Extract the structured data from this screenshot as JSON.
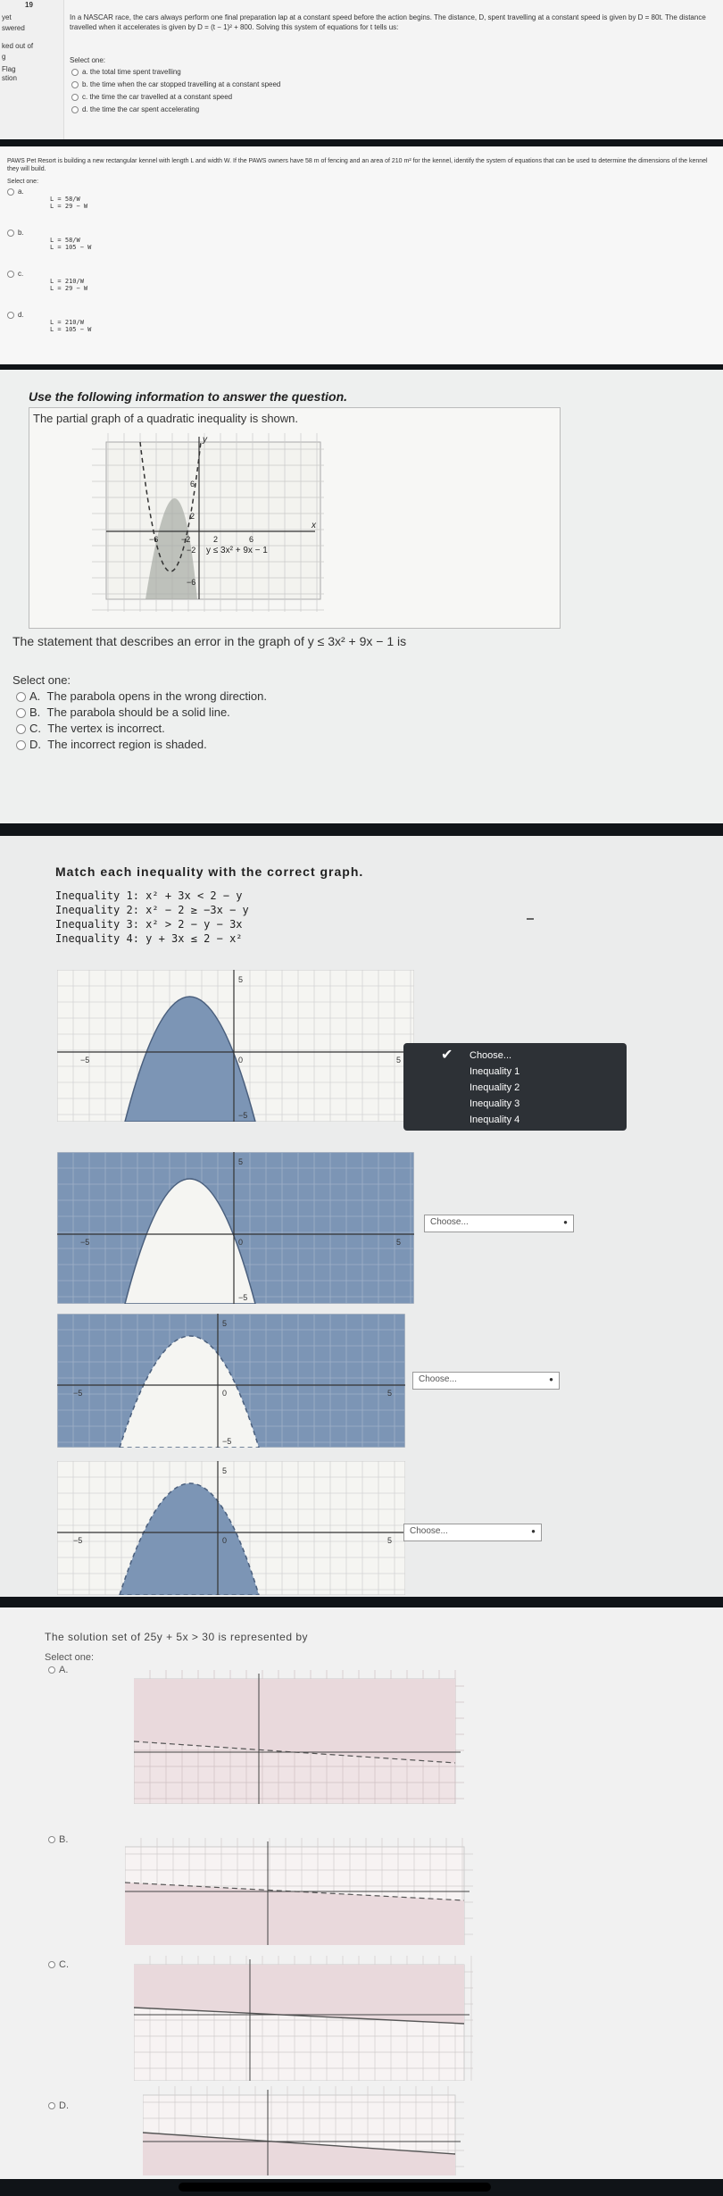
{
  "q1": {
    "sidebar": [
      "yet",
      "swered",
      "ked out of",
      "g",
      "Flag",
      "stion"
    ],
    "number": "19",
    "stem": "In a NASCAR race, the cars always perform one final preparation lap at a constant speed before the action begins. The distance, D, spent travelling at a constant speed is given by D = 80t. The distance travelled when it accelerates is given by D = (t − 1)² + 800. Solving this system of equations for t tells us:",
    "select": "Select one:",
    "options": [
      {
        "letter": "a.",
        "text": "the total time spent travelling"
      },
      {
        "letter": "b.",
        "text": "the time when the car stopped travelling at a constant speed"
      },
      {
        "letter": "c.",
        "text": "the time the car travelled at a constant speed"
      },
      {
        "letter": "d.",
        "text": "the time the car spent accelerating"
      }
    ]
  },
  "q2": {
    "stem": "PAWS Pet Resort is building a new rectangular kennel with length L and width W. If the PAWS owners have 58 m of fencing and an area of 210 m² for the kennel, identify the system of equations that can be used to determine the dimensions of the kennel they will build.",
    "select": "Select one:",
    "options": [
      {
        "letter": "a.",
        "eq1": "L = 58/W",
        "eq2": "L = 29 − W"
      },
      {
        "letter": "b.",
        "eq1": "L = 58/W",
        "eq2": "L = 105 − W"
      },
      {
        "letter": "c.",
        "eq1": "L = 210/W",
        "eq2": "L = 29 − W"
      },
      {
        "letter": "d.",
        "eq1": "L = 210/W",
        "eq2": "L = 105 − W"
      }
    ]
  },
  "q3": {
    "instruction": "Use the following information to answer the question.",
    "info": "The partial graph of a quadratic inequality is shown.",
    "graph_label": "y ≤ 3x² + 9x − 1",
    "ticks_x": [
      "−6",
      "−2",
      "2",
      "6"
    ],
    "ticks_y": [
      "6",
      "2",
      "−2",
      "−6"
    ],
    "axis_x": "x",
    "axis_y": "y",
    "statement": "The statement that describes an error in the graph of y ≤ 3x² + 9x − 1 is",
    "select": "Select one:",
    "options": [
      {
        "letter": "A.",
        "text": "The parabola opens in the wrong direction."
      },
      {
        "letter": "B.",
        "text": "The parabola should be a solid line."
      },
      {
        "letter": "C.",
        "text": "The vertex is incorrect."
      },
      {
        "letter": "D.",
        "text": "The incorrect region is shaded."
      }
    ]
  },
  "q4": {
    "title": "Match each inequality with the correct graph.",
    "inequalities": [
      "Inequality 1:  x² + 3x < 2 − y",
      "Inequality 2:  x² − 2 ≥ −3x − y",
      "Inequality 3:  x² > 2 − y − 3x",
      "Inequality 4:  y + 3x ≤ 2 − x²"
    ],
    "tick_labels": {
      "neg5": "−5",
      "pos5": "5",
      "zero": "0",
      "negy": "−5"
    },
    "menu_items": [
      "Choose...",
      "Inequality 1",
      "Inequality 2",
      "Inequality 3",
      "Inequality 4"
    ],
    "dropdowns": [
      "Choose...",
      "Choose...",
      "Choose..."
    ],
    "shade_color": "#7c95b5"
  },
  "q5": {
    "stem": "The solution set of 25y + 5x > 30 is represented by",
    "select": "Select one:",
    "options": [
      "A.",
      "B.",
      "C.",
      "D."
    ],
    "shade_color": "#e9d9dc"
  }
}
